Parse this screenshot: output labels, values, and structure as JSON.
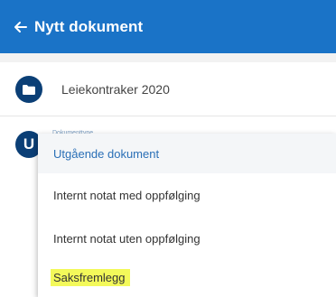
{
  "appbar": {
    "title": "Nytt dokument",
    "back_icon": "arrow-left-icon",
    "background_color": "#1a73c7"
  },
  "document_row": {
    "icon": "folder-icon",
    "text": "Leiekontraker 2020"
  },
  "type_row": {
    "label": "Dokumenttype",
    "avatar_letter": "U"
  },
  "dropdown": {
    "items": [
      {
        "label": "Utgående dokument",
        "selected": true
      },
      {
        "label": "Internt notat med oppfølging"
      },
      {
        "label": "Internt notat uten oppfølging"
      },
      {
        "label": "Saksfremlegg",
        "highlighted": true
      }
    ],
    "accent_color": "#2a6fb6",
    "highlight_color": "#f3f95a"
  }
}
